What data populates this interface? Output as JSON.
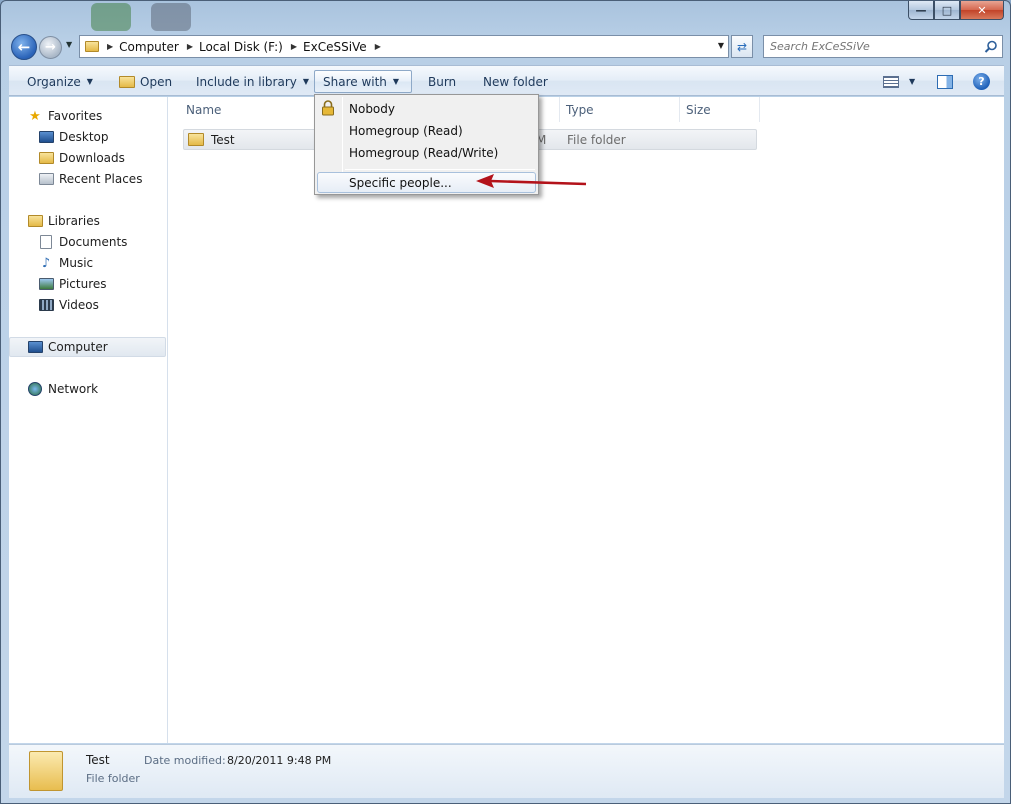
{
  "window": {
    "caption": {
      "minimize": "—",
      "maximize": "□",
      "close": "✕"
    }
  },
  "address": {
    "crumbs": [
      "Computer",
      "Local Disk (F:)",
      "ExCeSSiVe"
    ],
    "search_placeholder": "Search ExCeSSiVe"
  },
  "toolbar": {
    "organize": "Organize",
    "open": "Open",
    "include_in_library": "Include in library",
    "share_with": "Share with",
    "burn": "Burn",
    "new_folder": "New folder",
    "help": "?"
  },
  "sidebar": {
    "favorites": {
      "label": "Favorites",
      "items": [
        "Desktop",
        "Downloads",
        "Recent Places"
      ]
    },
    "libraries": {
      "label": "Libraries",
      "items": [
        "Documents",
        "Music",
        "Pictures",
        "Videos"
      ]
    },
    "computer": "Computer",
    "network": "Network"
  },
  "columns": {
    "name": "Name",
    "type": "Type",
    "size": "Size"
  },
  "files": [
    {
      "name": "Test",
      "date_fragment": "M",
      "type": "File folder"
    }
  ],
  "share_menu": {
    "items": [
      "Nobody",
      "Homegroup (Read)",
      "Homegroup (Read/Write)",
      "Specific people..."
    ]
  },
  "details": {
    "name": "Test",
    "date_label": "Date modified:",
    "date_value": "8/20/2011 9:48 PM",
    "type": "File folder"
  },
  "colors": {
    "accent": "#1e395b",
    "arrow": "#b3121a",
    "folder": "#e4b947"
  }
}
